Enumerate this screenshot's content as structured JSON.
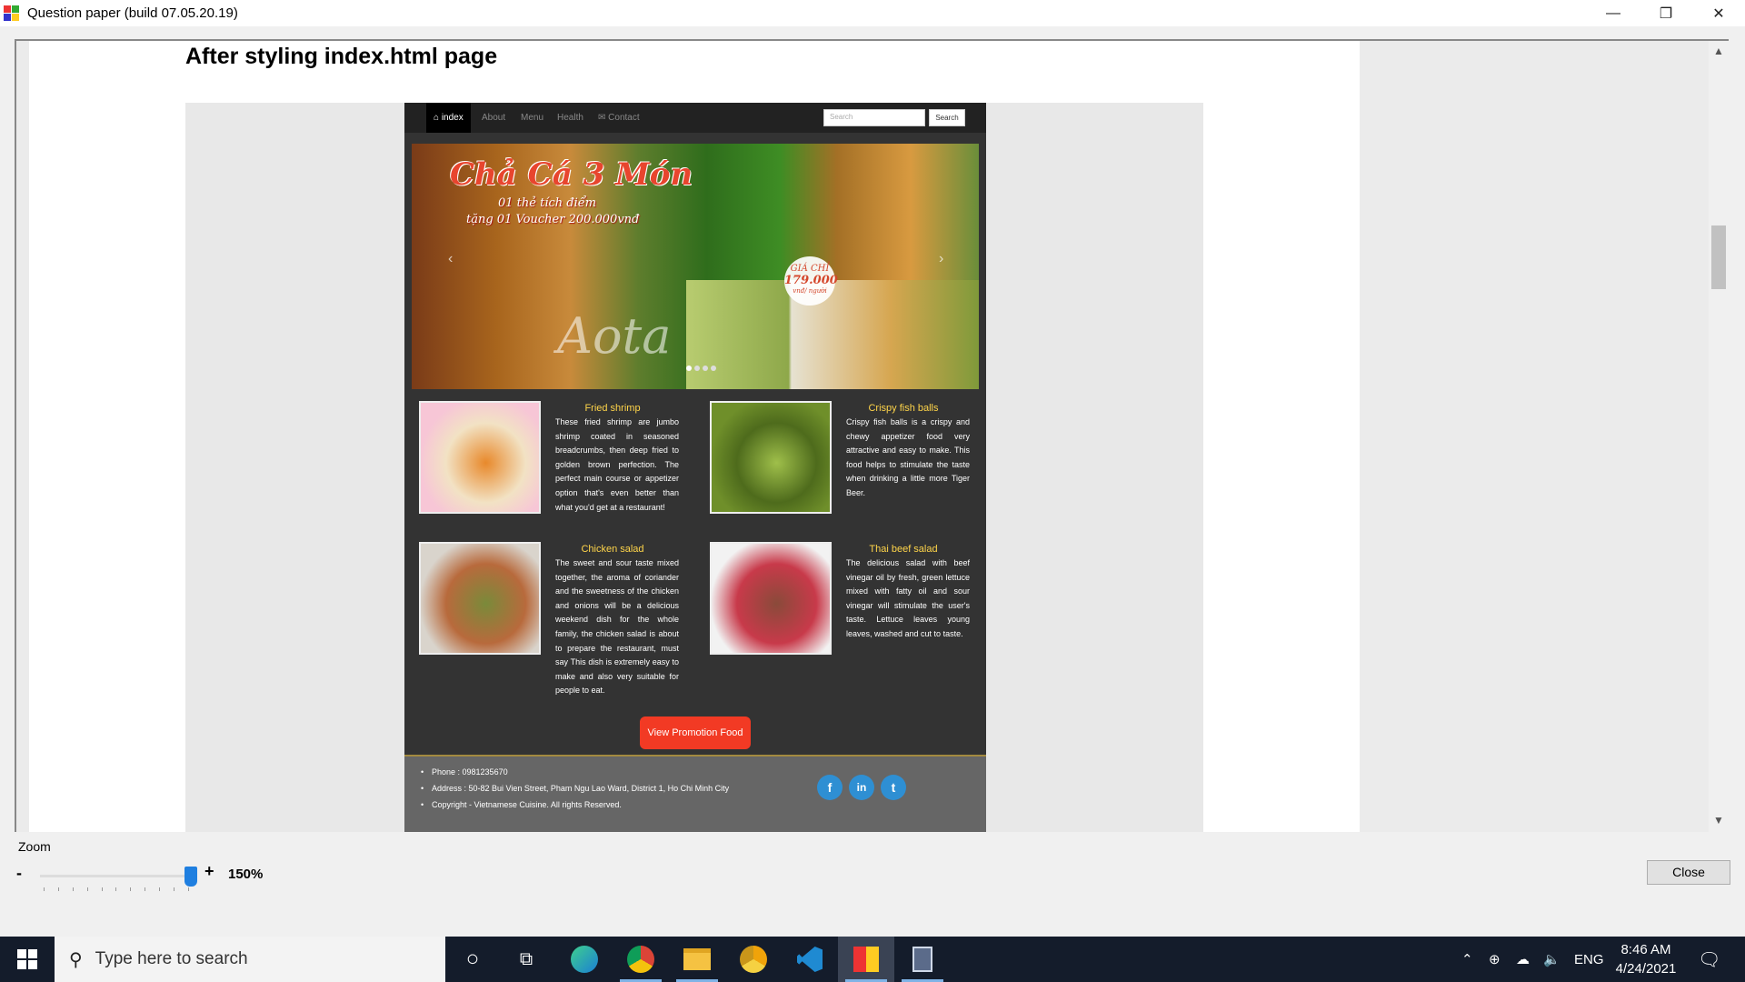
{
  "window": {
    "title": "Question paper (build 07.05.20.19)",
    "controls": {
      "minimize": "—",
      "restore": "❐",
      "close": "✕"
    }
  },
  "document": {
    "heading": "After styling index.html page"
  },
  "site": {
    "nav": {
      "items": [
        {
          "label": "index",
          "icon": "home-icon"
        },
        {
          "label": "About"
        },
        {
          "label": "Menu"
        },
        {
          "label": "Health"
        },
        {
          "label": "Contact",
          "icon": "mail-icon"
        }
      ],
      "search_placeholder": "Search",
      "search_button": "Search"
    },
    "banner": {
      "title": "Chả Cá 3 Món",
      "line1": "01 thẻ tích điểm",
      "line2": "tặng 01 Voucher 200.000vnđ",
      "price_label": "GIÁ CHỈ",
      "price": "179.000",
      "price_unit": "vnđ/ người",
      "logo": "Aota"
    },
    "foods": [
      {
        "title": "Fried shrimp",
        "desc": "These fried shrimp are jumbo shrimp coated in seasoned breadcrumbs, then deep fried to golden brown perfection. The perfect main course or appetizer option that's even better than what you'd get at a restaurant!",
        "colors": [
          "#f7c6d6",
          "#e8892b",
          "#f2e2c4"
        ]
      },
      {
        "title": "Crispy fish balls",
        "desc": "Crispy fish balls is a crispy and chewy appetizer food very attractive and easy to make. This food helps to stimulate the taste when drinking a little more Tiger Beer.",
        "colors": [
          "#6f8f2a",
          "#9fbf4a",
          "#4e6b1c"
        ]
      },
      {
        "title": "Chicken salad",
        "desc": "The sweet and sour taste mixed together, the aroma of coriander and the sweetness of the chicken and onions will be a delicious weekend dish for the whole family, the chicken salad is about to prepare the restaurant, must say This dish is extremely easy to make and also very suitable for people to eat.",
        "colors": [
          "#d9d4cc",
          "#7a8a3a",
          "#b86a3c"
        ]
      },
      {
        "title": "Thai beef salad",
        "desc": "The delicious salad with beef vinegar oil by fresh, green lettuce mixed with fatty oil and sour vinegar will stimulate the user's taste. Lettuce leaves young leaves, washed and cut to taste.",
        "colors": [
          "#f2f2f2",
          "#8a4a3a",
          "#c83a4a"
        ]
      }
    ],
    "promo_button": "View Promotion Food",
    "footer": {
      "items": [
        "Phone : 0981235670",
        "Address : 50-82 Bui Vien Street, Pham Ngu Lao Ward, District 1, Ho Chi Minh City",
        "Copyright - Vietnamese Cuisine. All rights Reserved."
      ],
      "social": [
        {
          "label": "f",
          "icon": "facebook-icon"
        },
        {
          "label": "in",
          "icon": "linkedin-icon"
        },
        {
          "label": "t",
          "icon": "twitter-icon"
        }
      ]
    }
  },
  "zoom": {
    "label": "Zoom",
    "minus": "-",
    "plus": "+",
    "value": "150%"
  },
  "close_button": "Close",
  "taskbar": {
    "search_placeholder": "Type here to search",
    "apps": [
      "cortana-icon",
      "task-view-icon",
      "edge-icon",
      "chrome-icon",
      "file-explorer-icon",
      "chrome-canary-icon",
      "vscode-icon",
      "question-paper-icon",
      "calculator-icon"
    ],
    "tray": {
      "lang": "ENG",
      "time": "8:46 AM",
      "date": "4/24/2021"
    }
  },
  "colors": {
    "accent_yellow": "#ffd54a",
    "promo_red": "#f23a24",
    "social_blue": "#2e8fd3",
    "zoom_blue": "#1f7fe0"
  }
}
